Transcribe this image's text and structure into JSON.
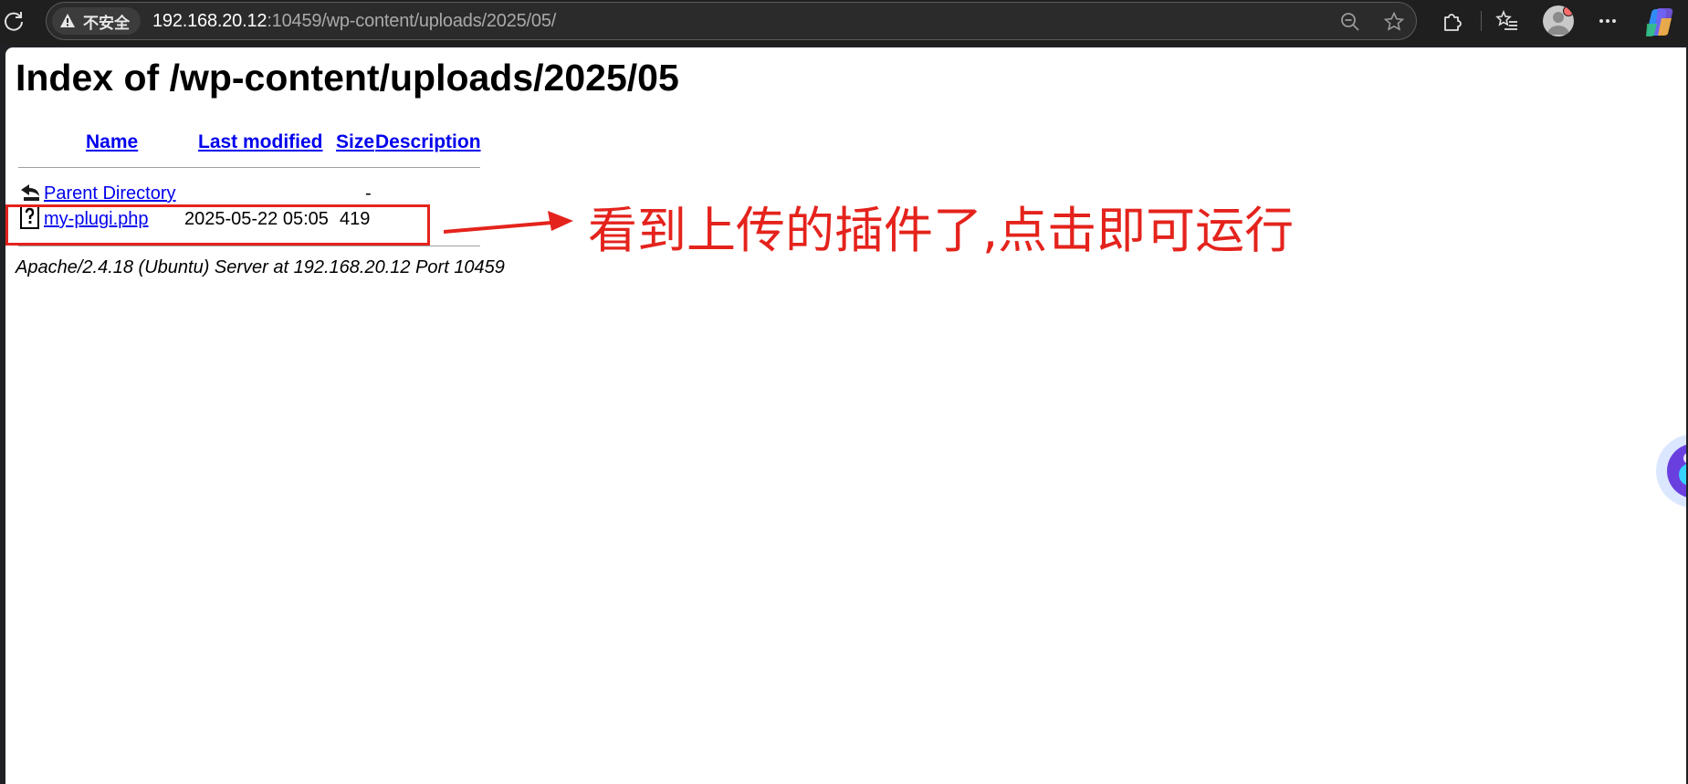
{
  "browser": {
    "security_label": "不安全",
    "url_host": "192.168.20.12",
    "url_path": ":10459/wp-content/uploads/2025/05/",
    "icons": [
      "reload-icon",
      "warning-icon",
      "zoom-out-icon",
      "star-icon",
      "extensions-icon",
      "favorites-icon",
      "profile-avatar",
      "more-icon",
      "copilot-icon"
    ]
  },
  "page": {
    "title": "Index of /wp-content/uploads/2025/05",
    "columns": {
      "name": "Name",
      "last_modified": "Last modified",
      "size": "Size",
      "description": "Description"
    },
    "rows": [
      {
        "name": "Parent Directory",
        "modified": "",
        "size": "-",
        "description": "",
        "icon": "back-folder-icon"
      },
      {
        "name": "my-plugi.php",
        "modified": "2025-05-22 05:05",
        "size": "419",
        "description": "",
        "icon": "unknown-file-icon"
      }
    ],
    "address": "Apache/2.4.18 (Ubuntu) Server at 192.168.20.12 Port 10459"
  },
  "annotation": {
    "text": "看到上传的插件了,点击即可运行",
    "color": "#e4231c"
  }
}
